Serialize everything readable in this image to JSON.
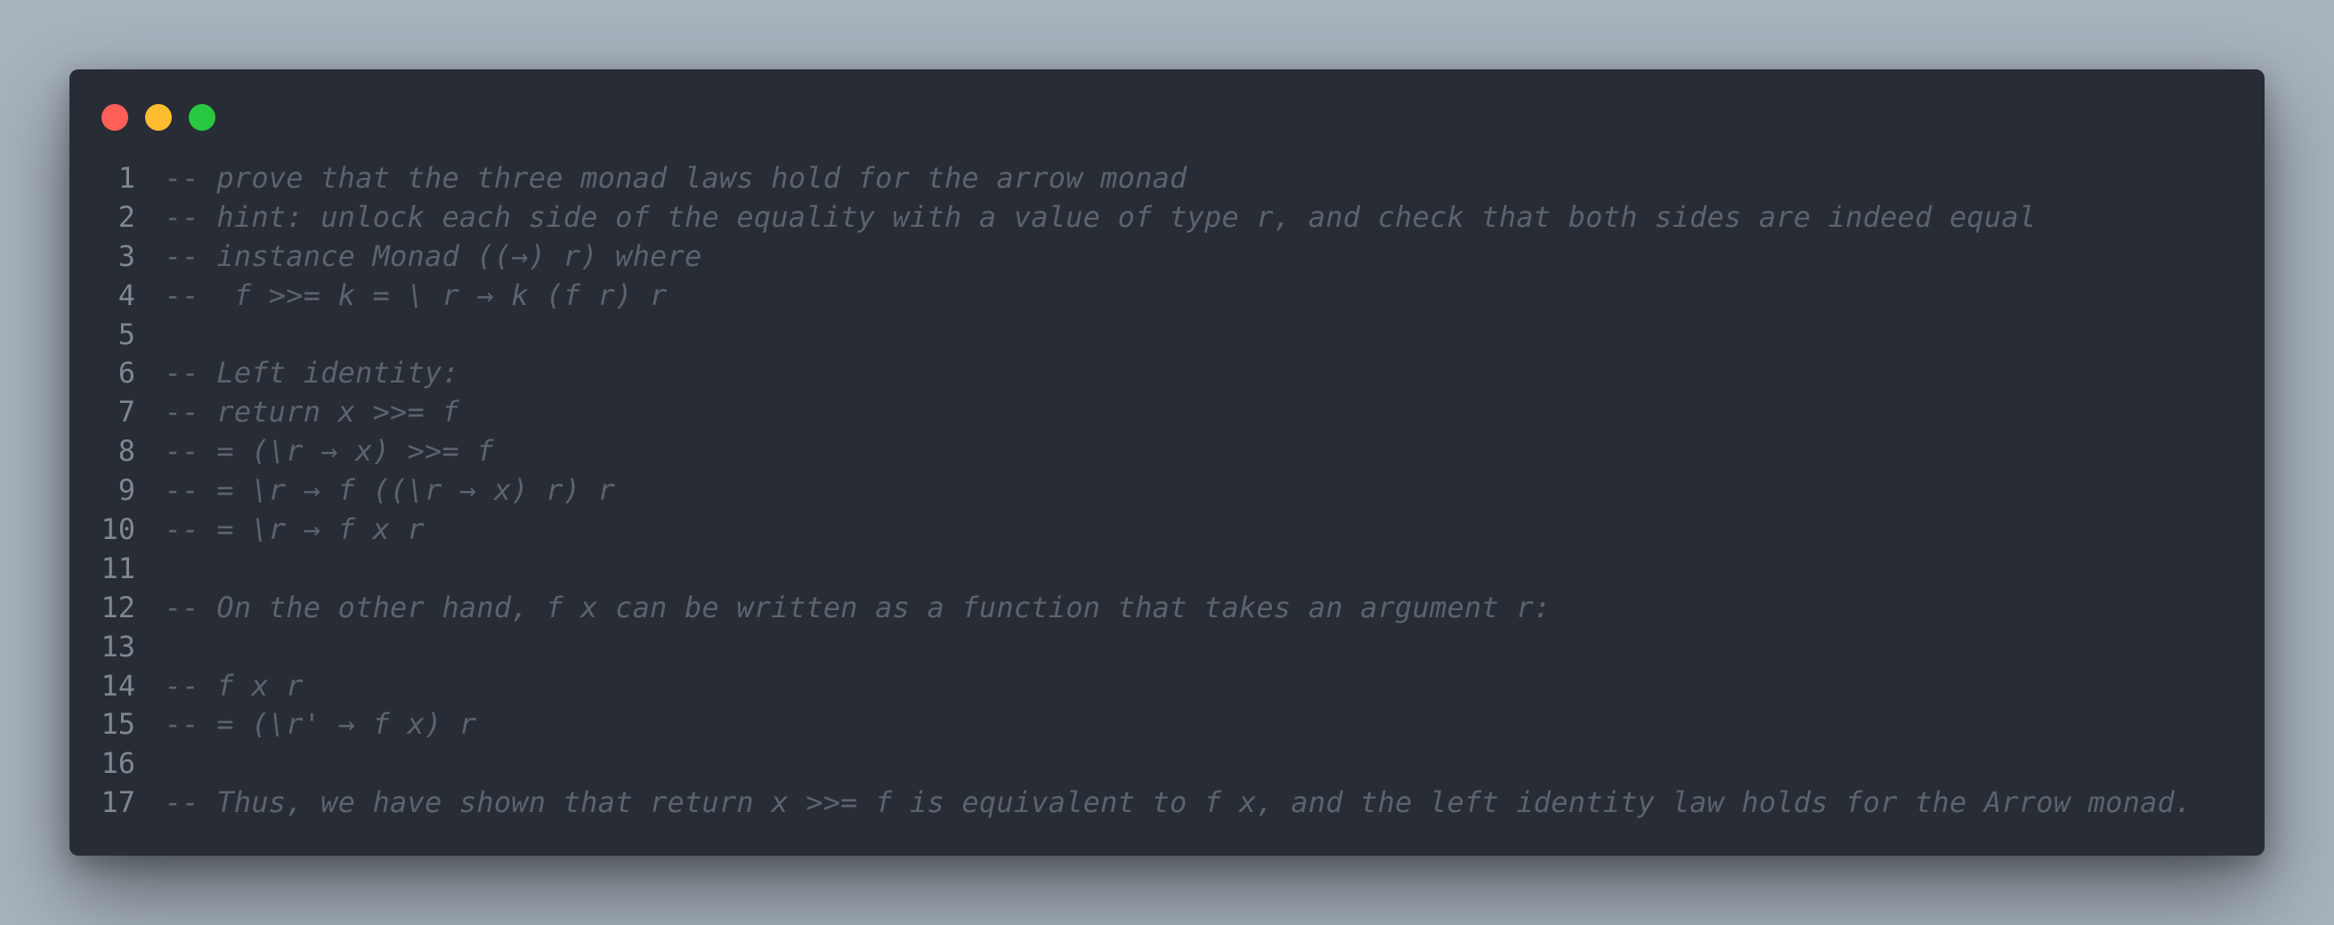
{
  "window": {
    "controls": {
      "close_color": "#ff5f57",
      "minimize_color": "#febc2e",
      "zoom_color": "#28c840"
    }
  },
  "editor": {
    "lines": [
      {
        "number": "1",
        "text": "-- prove that the three monad laws hold for the arrow monad"
      },
      {
        "number": "2",
        "text": "-- hint: unlock each side of the equality with a value of type r, and check that both sides are indeed equal"
      },
      {
        "number": "3",
        "text": "-- instance Monad ((→) r) where"
      },
      {
        "number": "4",
        "text": "--  f >>= k = \\ r → k (f r) r"
      },
      {
        "number": "5",
        "text": ""
      },
      {
        "number": "6",
        "text": "-- Left identity:"
      },
      {
        "number": "7",
        "text": "-- return x >>= f"
      },
      {
        "number": "8",
        "text": "-- = (\\r → x) >>= f"
      },
      {
        "number": "9",
        "text": "-- = \\r → f ((\\r → x) r) r"
      },
      {
        "number": "10",
        "text": "-- = \\r → f x r"
      },
      {
        "number": "11",
        "text": ""
      },
      {
        "number": "12",
        "text": "-- On the other hand, f x can be written as a function that takes an argument r:"
      },
      {
        "number": "13",
        "text": ""
      },
      {
        "number": "14",
        "text": "-- f x r"
      },
      {
        "number": "15",
        "text": "-- = (\\r' → f x) r"
      },
      {
        "number": "16",
        "text": ""
      },
      {
        "number": "17",
        "text": "-- Thus, we have shown that return x >>= f is equivalent to f x, and the left identity law holds for the Arrow monad."
      }
    ]
  }
}
